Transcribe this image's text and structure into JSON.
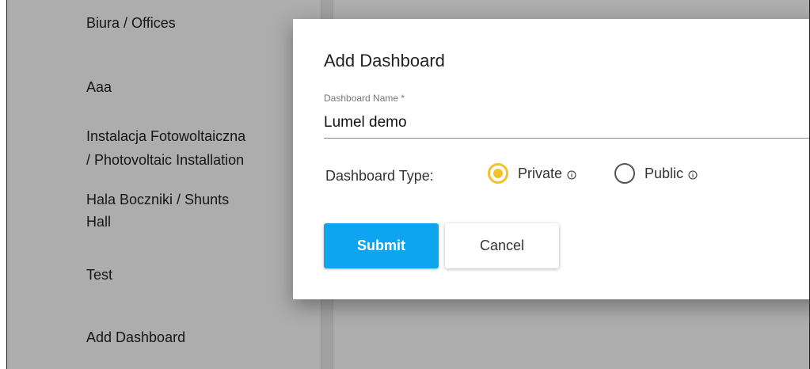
{
  "sidebar": {
    "items": [
      {
        "label": "Biura / Offices"
      },
      {
        "label": "Aaa"
      },
      {
        "label": "Instalacja Fotowoltaiczna"
      },
      {
        "label": "/ Photovoltaic Installation"
      },
      {
        "label": "Hala Boczniki / Shunts"
      },
      {
        "label": "Hall"
      },
      {
        "label": "Test"
      },
      {
        "label": "Add Dashboard"
      }
    ]
  },
  "dialog": {
    "title": "Add Dashboard",
    "name_field": {
      "label": "Dashboard Name *",
      "value": "Lumel demo"
    },
    "type_label": "Dashboard Type:",
    "type_options": [
      {
        "label": "Private",
        "selected": true
      },
      {
        "label": "Public",
        "selected": false
      }
    ],
    "submit_label": "Submit",
    "cancel_label": "Cancel"
  },
  "colors": {
    "accent_radio": "#f2c12e",
    "submit_bg": "#0ea5f0"
  }
}
